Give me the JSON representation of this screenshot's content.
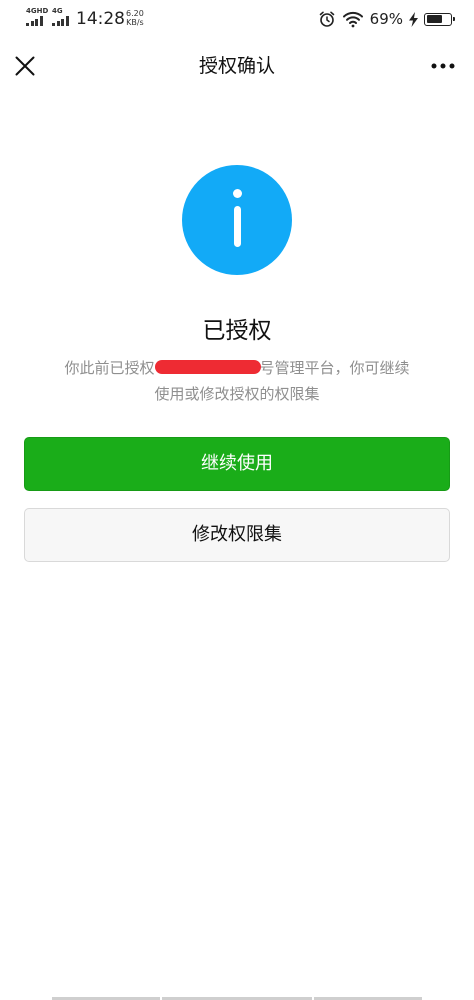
{
  "status_bar": {
    "sim1_network": "4GHD",
    "sim2_network": "4G",
    "time": "14:28",
    "net_speed_value": "6.20",
    "net_speed_unit": "KB/s",
    "battery_percent": "69%",
    "battery_level": 0.69,
    "icons": [
      "signal-icon",
      "alarm-clock-icon",
      "wifi-icon",
      "charging-bolt-icon",
      "battery-icon"
    ]
  },
  "nav": {
    "title": "授权确认",
    "close_icon": "close-icon",
    "more_icon": "more-options-icon"
  },
  "main": {
    "icon": "info-icon",
    "icon_color": "#12aaf7",
    "status_title": "已授权",
    "description_line1_start": "你此前已授权",
    "description_line1_end": "号管理平台，你可继续",
    "description_line2": "使用或修改授权的权限集",
    "redaction_color": "#ee2b33",
    "continue_button": "继续使用",
    "modify_button": "修改权限集",
    "primary_color": "#1aad19"
  }
}
